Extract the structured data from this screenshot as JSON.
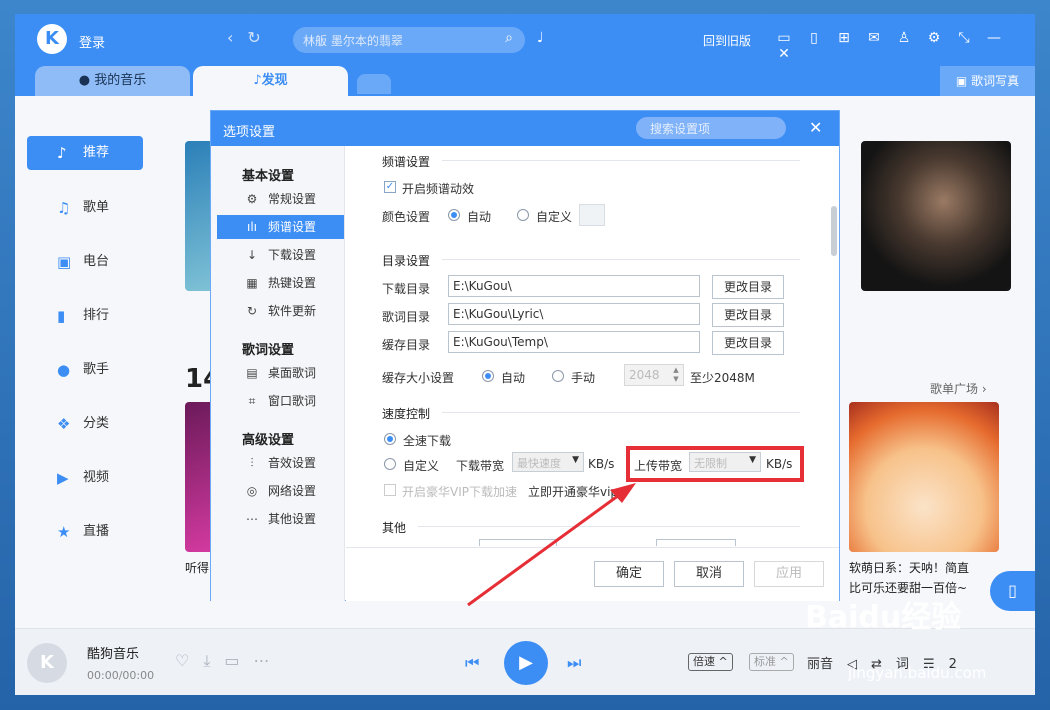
{
  "app": {
    "login": "登录",
    "search_placeholder": "林舨 墨尔本的翡翠",
    "old_version": "回到旧版",
    "tabs": [
      "我的音乐",
      "发现"
    ],
    "lyric_btn": "歌词写真"
  },
  "sidebar": [
    {
      "icon": "thumb-icon",
      "label": "推荐",
      "glyph": "♪"
    },
    {
      "icon": "playlist-icon",
      "label": "歌单",
      "glyph": "♫"
    },
    {
      "icon": "radio-icon",
      "label": "电台",
      "glyph": "▣"
    },
    {
      "icon": "rank-icon",
      "label": "排行",
      "glyph": "▮"
    },
    {
      "icon": "singer-icon",
      "label": "歌手",
      "glyph": "●"
    },
    {
      "icon": "category-icon",
      "label": "分类",
      "glyph": "❖"
    },
    {
      "icon": "video-icon",
      "label": "视频",
      "glyph": "▶"
    },
    {
      "icon": "live-icon",
      "label": "直播",
      "glyph": "★"
    }
  ],
  "content": {
    "heading_partial": "14",
    "more": "歌单广场 ›",
    "caption_left": "听得",
    "caption_right_1": "软萌日系：天呐！简直",
    "caption_right_2": "比可乐还要甜一百倍~"
  },
  "player": {
    "title": "酷狗音乐",
    "time": "00:00/00:00",
    "speed": "倍速",
    "quality": "标准",
    "right_label": "丽音",
    "count": "2"
  },
  "dialog": {
    "title": "选项设置",
    "search_placeholder": "搜索设置项",
    "nav_groups": [
      {
        "title": "基本设置",
        "items": [
          {
            "icon": "gear-icon",
            "glyph": "⚙",
            "label": "常规设置"
          },
          {
            "icon": "spectrum-icon",
            "glyph": "ılı",
            "label": "频谱设置"
          },
          {
            "icon": "download-icon",
            "glyph": "↓",
            "label": "下载设置"
          },
          {
            "icon": "keyboard-icon",
            "glyph": "▦",
            "label": "热键设置"
          },
          {
            "icon": "update-icon",
            "glyph": "↻",
            "label": "软件更新"
          }
        ]
      },
      {
        "title": "歌词设置",
        "items": [
          {
            "icon": "desktop-lyric-icon",
            "glyph": "▤",
            "label": "桌面歌词"
          },
          {
            "icon": "window-lyric-icon",
            "glyph": "⌗",
            "label": "窗口歌词"
          }
        ]
      },
      {
        "title": "高级设置",
        "items": [
          {
            "icon": "equalizer-icon",
            "glyph": "⫶",
            "label": "音效设置"
          },
          {
            "icon": "network-icon",
            "glyph": "◎",
            "label": "网络设置"
          },
          {
            "icon": "more-icon",
            "glyph": "⋯",
            "label": "其他设置"
          }
        ]
      }
    ],
    "spectrum": {
      "title": "频谱设置",
      "enable": "开启频谱动效",
      "color_label": "颜色设置",
      "auto": "自动",
      "custom": "自定义"
    },
    "directory": {
      "title": "目录设置",
      "download_label": "下载目录",
      "download_value": "E:\\KuGou\\",
      "lyric_label": "歌词目录",
      "lyric_value": "E:\\KuGou\\Lyric\\",
      "cache_label": "缓存目录",
      "cache_value": "E:\\KuGou\\Temp\\",
      "change_btn": "更改目录",
      "cache_size_label": "缓存大小设置",
      "auto": "自动",
      "manual": "手动",
      "cache_size_value": "2048",
      "min_note": "至少2048M"
    },
    "speed": {
      "title": "速度控制",
      "full": "全速下载",
      "custom": "自定义",
      "download_bw": "下载带宽",
      "download_sel": "最快速度",
      "unit": "KB/s",
      "upload_bw": "上传带宽",
      "upload_sel": "无限制",
      "vip_accel": "开启豪华VIP下载加速",
      "vip_link": "立即开通豪华vip"
    },
    "other": {
      "title": "其他"
    },
    "footer": {
      "ok": "确定",
      "cancel": "取消",
      "apply": "应用"
    }
  },
  "watermark": {
    "brand": "Baidu经验",
    "url": "jingyan.baidu.com"
  },
  "colors": {
    "accent": "#3c8ef5",
    "highlight": "#e62e36"
  }
}
